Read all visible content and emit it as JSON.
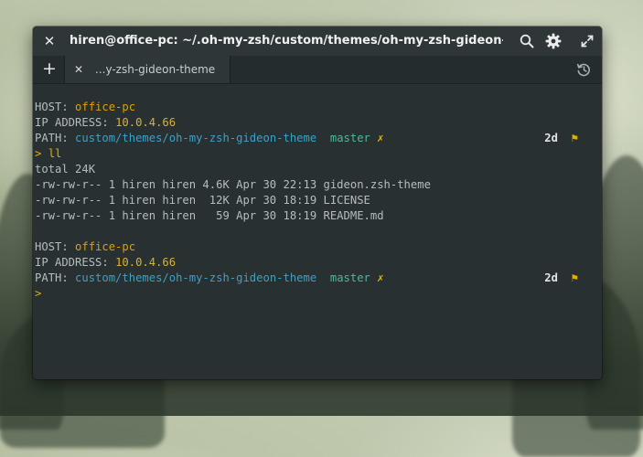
{
  "window": {
    "title": "hiren@office-pc: ~/.oh-my-zsh/custom/themes/oh-my-zsh-gideon-theme"
  },
  "tab": {
    "label": "...y-zsh-gideon-theme"
  },
  "icons": {
    "close": "close-icon",
    "search": "search-icon",
    "settings": "gear-icon",
    "maximize": "maximize-icon",
    "new_tab": "plus-icon",
    "history": "history-icon"
  },
  "terminal": {
    "block1": {
      "host_label": "HOST: ",
      "host": "office-pc",
      "ip_label": "IP ADDRESS: ",
      "ip": "10.0.4.66",
      "path_label": "PATH: ",
      "path": "custom/themes/oh-my-zsh-gideon-theme",
      "branch": "master",
      "dirty": "✗",
      "age": "2d",
      "flag": "⚑",
      "prompt": ">",
      "command": "ll"
    },
    "output": [
      "total 24K",
      "-rw-rw-r-- 1 hiren hiren 4.6K Apr 30 22:13 gideon.zsh-theme",
      "-rw-rw-r-- 1 hiren hiren  12K Apr 30 18:19 LICENSE",
      "-rw-rw-r-- 1 hiren hiren   59 Apr 30 18:19 README.md"
    ],
    "block2": {
      "host_label": "HOST: ",
      "host": "office-pc",
      "ip_label": "IP ADDRESS: ",
      "ip": "10.0.4.66",
      "path_label": "PATH: ",
      "path": "custom/themes/oh-my-zsh-gideon-theme",
      "branch": "master",
      "dirty": "✗",
      "age": "2d",
      "flag": "⚑",
      "prompt": ">"
    }
  },
  "colors": {
    "terminal_bg": "#283032",
    "host": "#e0a000",
    "path": "#3ea1c4",
    "branch": "#4db99b",
    "text": "#b7bcbd"
  }
}
